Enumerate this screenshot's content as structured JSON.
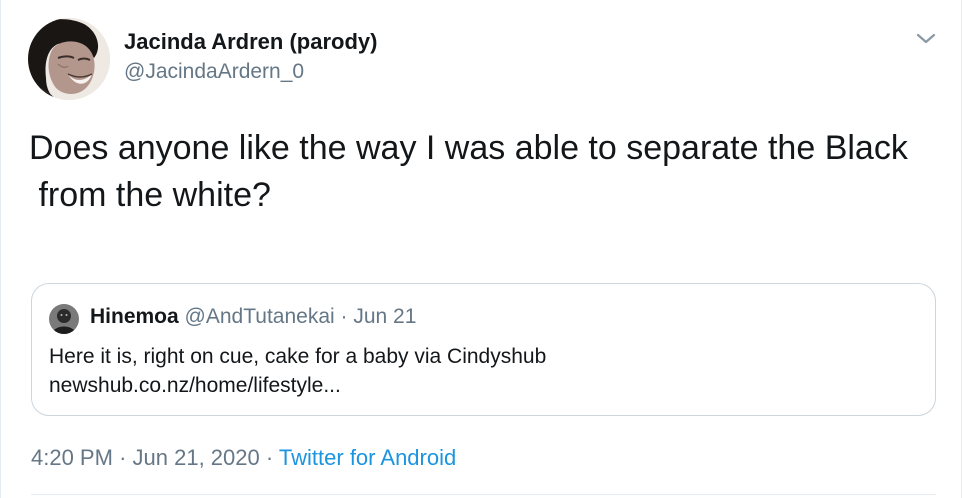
{
  "author": {
    "display_name": "Jacinda Ardren (parody)",
    "handle": "@JacindaArdern_0"
  },
  "menu": {
    "icon": "chevron-down-icon"
  },
  "tweet": {
    "text": "Does anyone like the way I was able to separate the Black\n from the white?"
  },
  "quoted_tweet": {
    "display_name": "Hinemoa",
    "handle": "@AndTutanekai",
    "separator": "·",
    "date": "Jun 21",
    "text_line1": "Here it is, right on cue, cake for a baby via Cindyshub",
    "text_line2": "newshub.co.nz/home/lifestyle..."
  },
  "footer": {
    "time": "4:20 PM",
    "separator": "·",
    "date": "Jun 21, 2020",
    "source": "Twitter for Android"
  },
  "colors": {
    "text_primary": "#14171a",
    "text_secondary": "#657786",
    "link": "#1b95e0",
    "border": "#ccd6dd"
  }
}
